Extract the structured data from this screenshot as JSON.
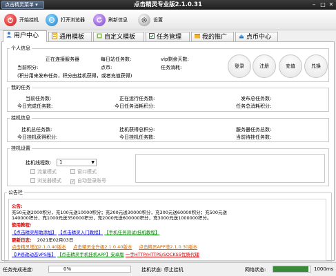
{
  "titlebar": {
    "menu": "点击精灵菜单 ▾",
    "title": "点击精灵专业版2.1.0.31",
    "minimize": "–",
    "maximize": "□",
    "close": "✕"
  },
  "toolbar": {
    "start": "开始挂机",
    "browser": "打开浏览器",
    "refresh": "刷新信息",
    "settings": "设置"
  },
  "tabs": [
    "用户中心",
    "通用模板",
    "自定义模板",
    "任务管理",
    "我的推广",
    "点币中心"
  ],
  "personal": {
    "legend": "个人信息",
    "connecting": "正在连接服务器",
    "daily_tasks": "每日站任务数:",
    "vip_days": "vip剩余天数:",
    "current_points": "当前积分:",
    "coins": "点币:",
    "task_consume": "任务消耗:",
    "note": "(积分用来发布任务，积分由挂机获得，或者充值获得)",
    "login": "登录",
    "register": "注册",
    "recharge": "充值",
    "exchange": "兑换"
  },
  "mytasks": {
    "legend": "我的任务",
    "current": "当前任务数:",
    "running": "正在运行任务数:",
    "published": "发布总任务数:",
    "today_done": "今日完成任务数:",
    "today_points": "今日任务消耗积分:",
    "total_points": "任务总消耗积分:"
  },
  "hangup": {
    "legend": "挂机信息",
    "total": "挂机总任务数:",
    "total_points": "挂机获得总积分:",
    "server": "服务器任务总数:",
    "today_points": "今日挂机获得积分:",
    "today_tasks": "今日挂机任务数:",
    "pending": "当前待挂任务数:"
  },
  "hangsettings": {
    "legend": "挂机设置",
    "threads_label": "挂机线程数:",
    "threads_value": "1",
    "traffic": "流量模式",
    "window": "窗口模式",
    "browser": "浏览器模式",
    "auto_login": "自动登录账号"
  },
  "notice": {
    "legend": "公告栏",
    "title": "公告:",
    "line1": "充50元送2000积分，充100元送10000积分；充200元送30000积分，充300元送60000积分；充500元送",
    "line2": "140000积分，充1000元送350000积分，充2000元送600000积分，充3000元送1000000积分。",
    "tutorial_title": "使用教程:",
    "tut1": "【点击精灵帮助添加】",
    "tut2": "【点击精灵入门教程】",
    "tut3": "【手机任务测试\\挂机教程】",
    "update_title": "更新日志:",
    "update_date": "2021年02月03日",
    "upd1": "点击精灵增加2.1.0.40版本",
    "upd2": "点击精灵全升级2.1.0.40版本",
    "upd3": "点击精灵APP增2.1.0.30版本",
    "bottom1": "【IP修改动态VPS账】",
    "bottom2": "【点击精灵手机挂机APP】安卓版",
    "bottom3": "一手HTTP/HTTPS/SOCKS5优质代理"
  },
  "status": {
    "progress_label": "任务完成进度:",
    "progress_value": "0%",
    "progress_fraction": 0,
    "hang_status": "挂机状态: 停止挂机",
    "net_label": "网络状态:",
    "net_value": "1000ms",
    "net_fraction": 0.95
  }
}
